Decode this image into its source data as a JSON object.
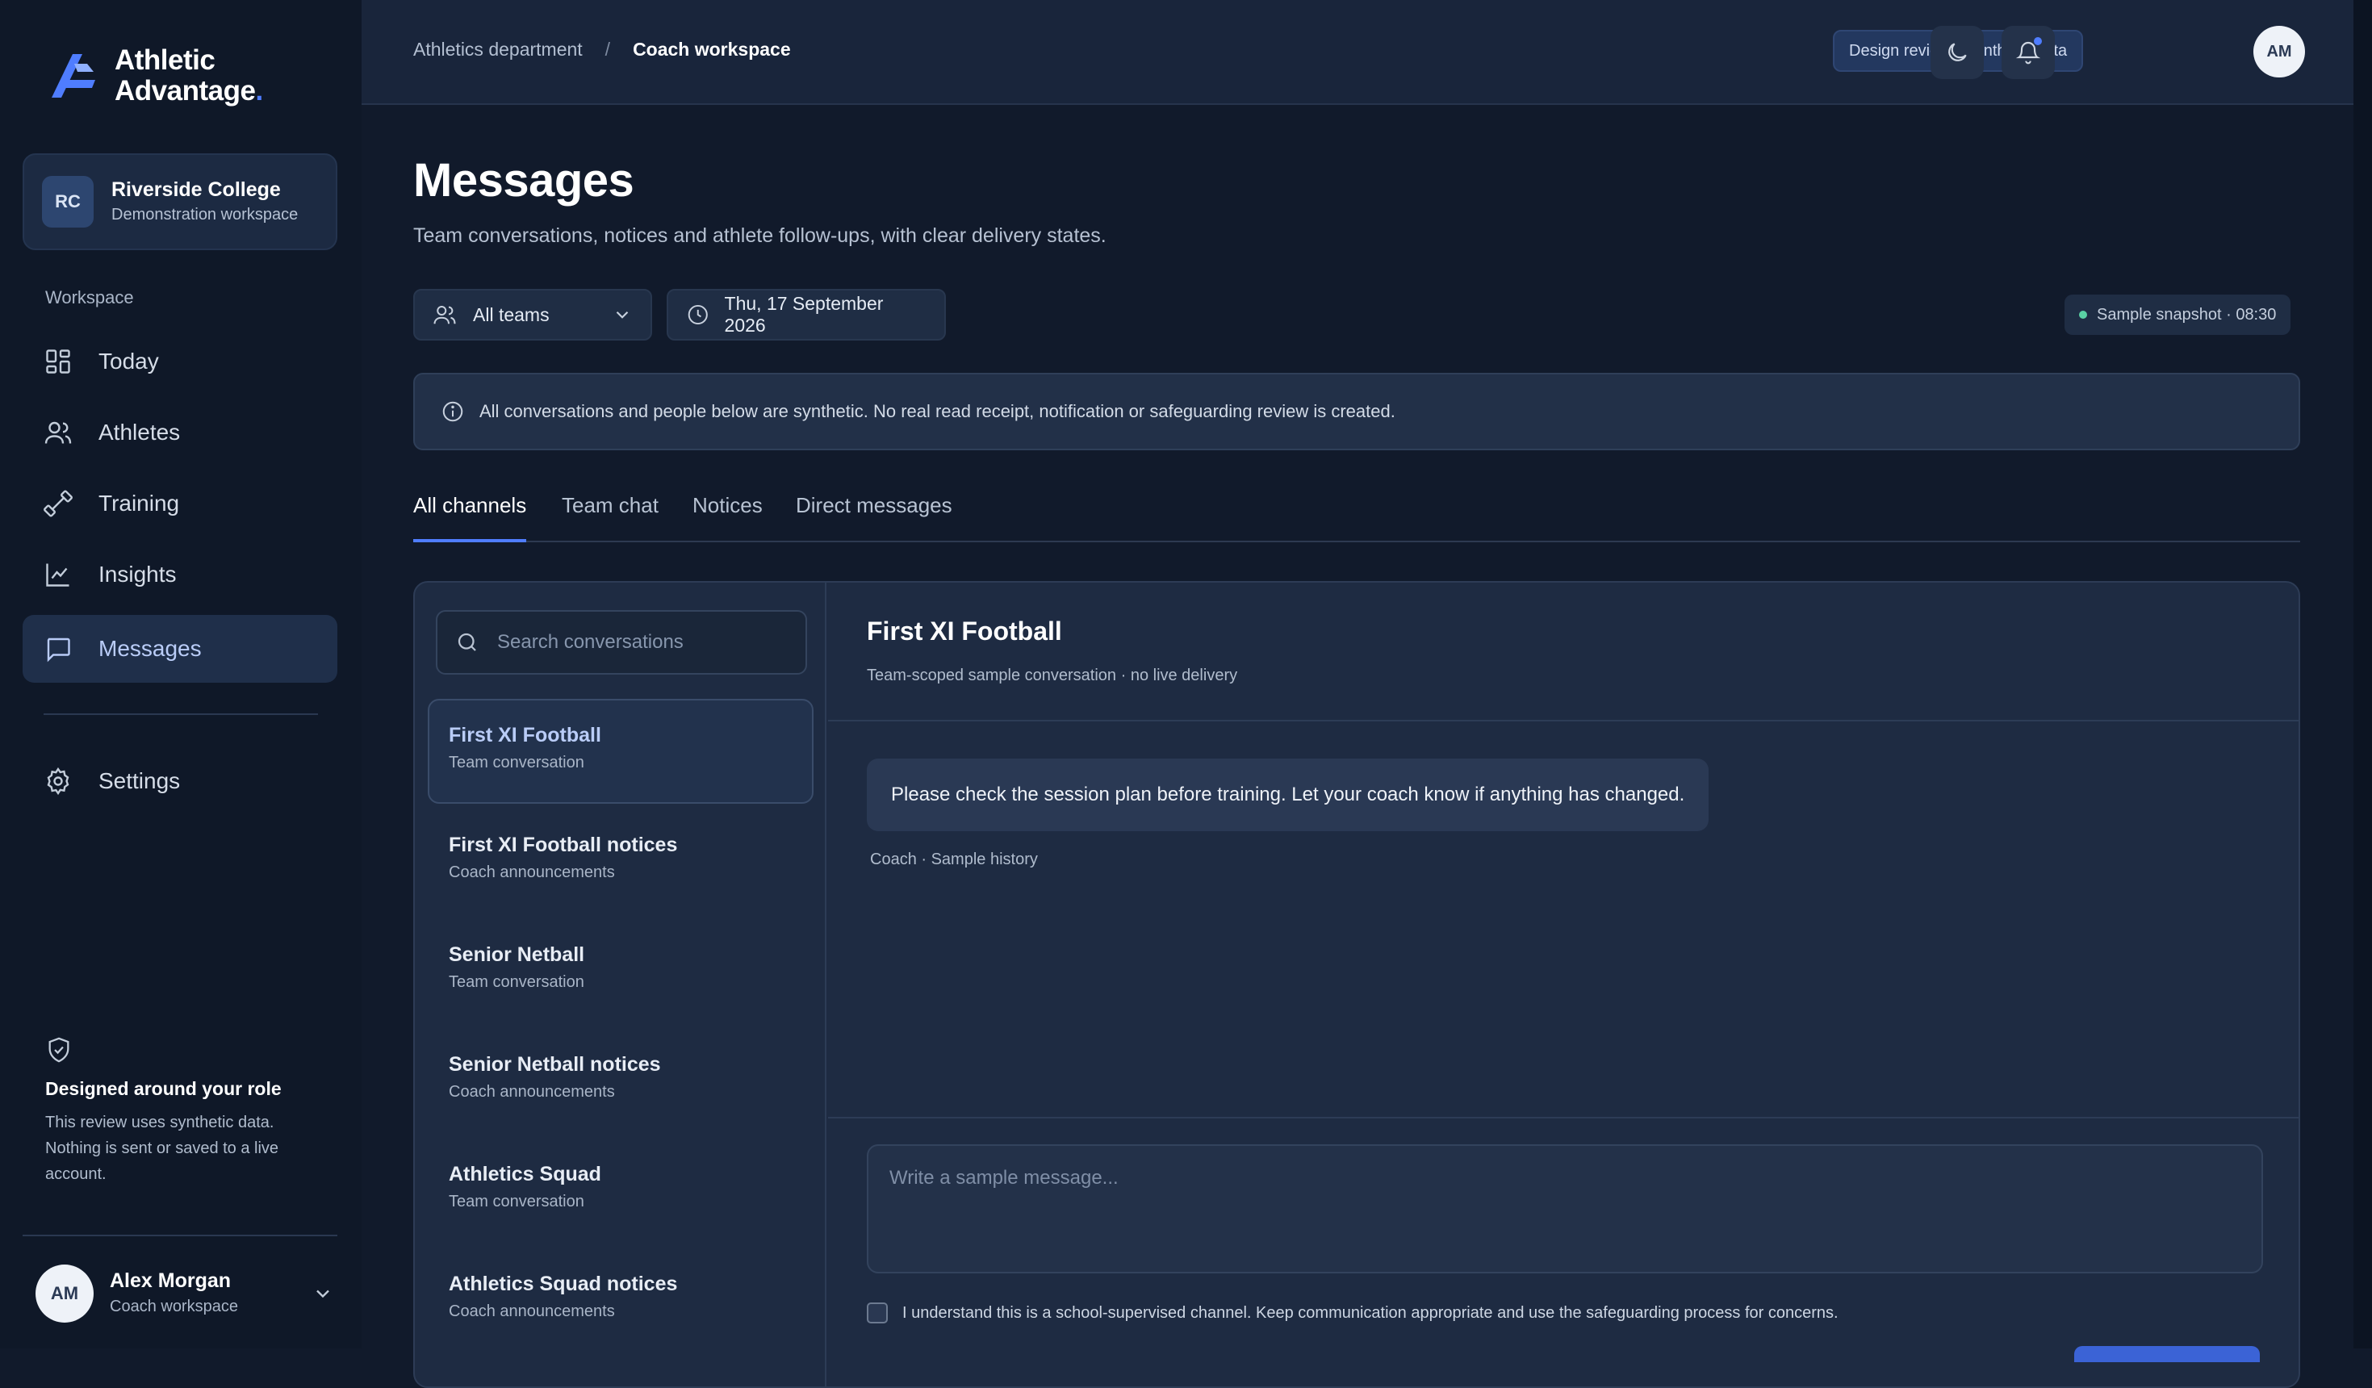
{
  "brand": {
    "name_line1": "Athletic",
    "name_line2": "Advantage",
    "accent": "#4f7dff"
  },
  "org": {
    "initials": "RC",
    "name": "Riverside College",
    "subtitle": "Demonstration workspace"
  },
  "sidebar": {
    "section_label": "Workspace",
    "items": [
      {
        "label": "Today",
        "icon": "dashboard-icon"
      },
      {
        "label": "Athletes",
        "icon": "users-icon"
      },
      {
        "label": "Training",
        "icon": "dumbbell-icon"
      },
      {
        "label": "Insights",
        "icon": "chart-line-icon"
      },
      {
        "label": "Messages",
        "icon": "message-square-icon",
        "active": true
      }
    ],
    "settings_label": "Settings",
    "role_card": {
      "title": "Designed around your role",
      "text": "This review uses synthetic data. Nothing is sent or saved to a live account."
    },
    "user": {
      "initials": "AM",
      "name": "Alex Morgan",
      "role": "Coach workspace"
    }
  },
  "topbar": {
    "breadcrumb": [
      "Athletics department",
      "Coach workspace"
    ],
    "breadcrumb_separator": "/",
    "badge": "Design review · Synthetic data",
    "avatar_initials": "AM"
  },
  "page": {
    "title": "Messages",
    "subtitle": "Team conversations, notices and athlete follow-ups, with clear delivery states."
  },
  "filters": {
    "team": "All teams",
    "date": "Thu, 17 September 2026",
    "snapshot": "Sample snapshot · 08:30"
  },
  "notice": "All conversations and people below are synthetic. No real read receipt, notification or safeguarding review is created.",
  "tabs": [
    "All channels",
    "Team chat",
    "Notices",
    "Direct messages"
  ],
  "search": {
    "placeholder": "Search conversations"
  },
  "conversations": [
    {
      "name": "First XI Football",
      "type": "Team conversation",
      "active": true
    },
    {
      "name": "First XI Football notices",
      "type": "Coach announcements"
    },
    {
      "name": "Senior Netball",
      "type": "Team conversation"
    },
    {
      "name": "Senior Netball notices",
      "type": "Coach announcements"
    },
    {
      "name": "Athletics Squad",
      "type": "Team conversation"
    },
    {
      "name": "Athletics Squad notices",
      "type": "Coach announcements"
    }
  ],
  "thread": {
    "title": "First XI Football",
    "subtitle": "Team-scoped sample conversation · no live delivery",
    "messages": [
      {
        "text": "Please check the session plan before training. Let your coach know if anything has changed.",
        "meta": "Coach · Sample history"
      }
    ]
  },
  "composer": {
    "placeholder": "Write a sample message...",
    "consent": "I understand this is a school-supervised channel. Keep communication appropriate and use the safeguarding process for concerns."
  }
}
